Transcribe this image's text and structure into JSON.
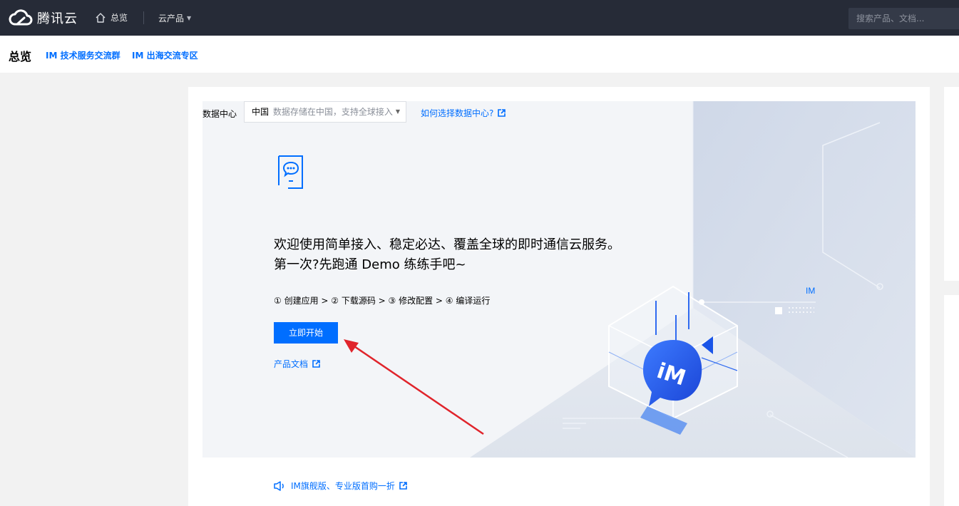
{
  "topbar": {
    "brand": "腾讯云",
    "home_label": "总览",
    "products_label": "云产品",
    "search_placeholder": "搜索产品、文档..."
  },
  "subheader": {
    "title": "总览",
    "links": [
      "IM 技术服务交流群",
      "IM 出海交流专区"
    ]
  },
  "hero": {
    "data_center_label": "数据中心",
    "data_center_value": "中国",
    "data_center_hint": "数据存储在中国，支持全球接入",
    "data_center_help": "如何选择数据中心?",
    "welcome_line1": "欢迎使用简单接入、稳定必达、覆盖全球的即时通信云服务。",
    "welcome_line2": "第一次?先跑通 Demo 练练手吧~",
    "steps": "① 创建应用 > ② 下载源码 > ③ 修改配置 > ④ 编译运行",
    "start_button": "立即开始",
    "doc_link": "产品文档",
    "art_label": "IM",
    "badge_text": "iM"
  },
  "promo": {
    "text": "IM旗舰版、专业版首购一折"
  },
  "icons": {
    "logo": "cloud-logo-icon",
    "home": "home-icon",
    "doc": "chat-document-icon",
    "external": "external-link-icon",
    "speaker": "speaker-icon"
  },
  "colors": {
    "topbar_bg": "#262b37",
    "accent": "#006eff",
    "annotation_arrow": "#e0242b"
  }
}
